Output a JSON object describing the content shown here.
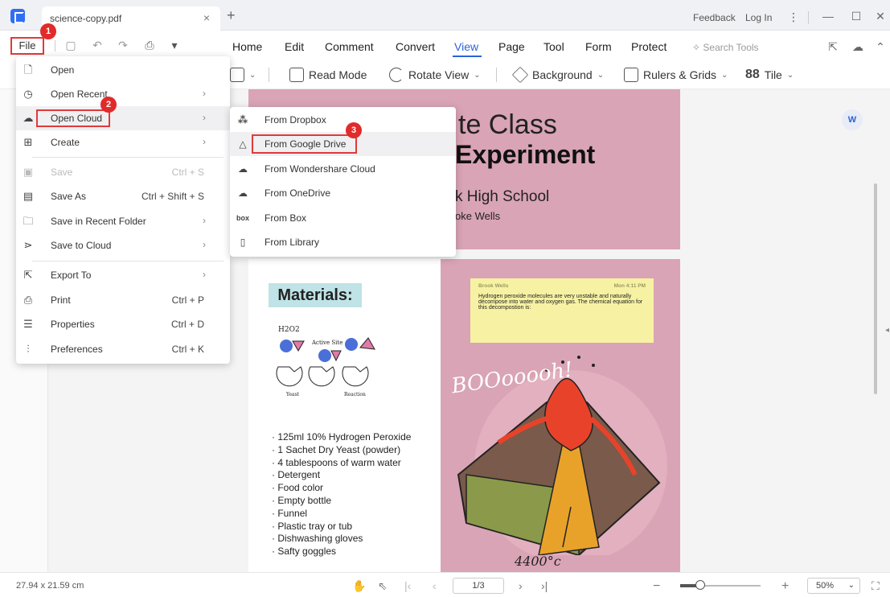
{
  "titlebar": {
    "tab_title": "science-copy.pdf",
    "tab_close": "×",
    "tab_add": "+",
    "feedback": "Feedback",
    "login": "Log In",
    "more": "⋮",
    "minimize": "—",
    "maximize": "☐",
    "close": "✕"
  },
  "ribbon": {
    "file_label": "File",
    "tabs": [
      {
        "label": "Home"
      },
      {
        "label": "Edit"
      },
      {
        "label": "Comment"
      },
      {
        "label": "Convert"
      },
      {
        "label": "View"
      },
      {
        "label": "Page"
      },
      {
        "label": "Tool"
      },
      {
        "label": "Form"
      },
      {
        "label": "Protect"
      }
    ],
    "active_tab": "View",
    "search_tools": "Search Tools",
    "accent_color": "#2b63d9"
  },
  "toolbar": {
    "read_mode": "Read Mode",
    "rotate_view": "Rotate View",
    "background": "Background",
    "rulers_grids": "Rulers & Grids",
    "tile": "Tile"
  },
  "file_menu": {
    "items": [
      {
        "label": "Open",
        "shortcut": "",
        "icon": "open-icon"
      },
      {
        "label": "Open Recent",
        "shortcut": "",
        "icon": "clock-icon",
        "arrow": "›"
      },
      {
        "label": "Open Cloud",
        "shortcut": "",
        "icon": "cloud-icon",
        "arrow": "›"
      },
      {
        "label": "Create",
        "shortcut": "",
        "icon": "plus-icon",
        "arrow": "›"
      },
      {
        "label": "Save",
        "shortcut": "Ctrl + S",
        "icon": "save-icon",
        "disabled": true
      },
      {
        "label": "Save As",
        "shortcut": "Ctrl + Shift + S",
        "icon": "save-as-icon"
      },
      {
        "label": "Save in Recent Folder",
        "shortcut": "",
        "icon": "folder-icon",
        "arrow": "›"
      },
      {
        "label": "Save to Cloud",
        "shortcut": "",
        "icon": "cloud-upload-icon",
        "arrow": "›"
      },
      {
        "label": "Export To",
        "shortcut": "",
        "icon": "export-icon",
        "arrow": "›"
      },
      {
        "label": "Print",
        "shortcut": "Ctrl + P",
        "icon": "print-icon"
      },
      {
        "label": "Properties",
        "shortcut": "Ctrl + D",
        "icon": "list-icon"
      },
      {
        "label": "Preferences",
        "shortcut": "Ctrl + K",
        "icon": "sliders-icon"
      }
    ]
  },
  "cloud_menu": {
    "items": [
      {
        "label": "From Dropbox",
        "icon": "dropbox-icon"
      },
      {
        "label": "From Google Drive",
        "icon": "google-drive-icon"
      },
      {
        "label": "From Wondershare Cloud",
        "icon": "wondershare-cloud-icon"
      },
      {
        "label": "From OneDrive",
        "icon": "onedrive-icon"
      },
      {
        "label": "From Box",
        "icon": "box-icon"
      },
      {
        "label": "From Library",
        "icon": "library-icon"
      }
    ]
  },
  "badges": [
    "1",
    "2",
    "3"
  ],
  "document": {
    "title_line1": "te Class",
    "title_line2": "Experiment",
    "school": "k High School",
    "author": "oke Wells",
    "materials_heading": "Materials:",
    "materials": [
      "125ml 10% Hydrogen Peroxide",
      "1 Sachet Dry Yeast (powder)",
      "4 tablespoons of warm water",
      "Detergent",
      "Food color",
      "Empty bottle",
      "Funnel",
      "Plastic tray or tub",
      "Dishwashing gloves",
      "Safty goggles"
    ],
    "sticky_author": "Brook Wells",
    "sticky_time": "Mon 4:11 PM",
    "sticky_text": "Hydrogen peroxide molecules are very unstable and naturally decompose into water and oxygen gas. The chemical equation for this decompostion is:",
    "diagram_h2o2": "H2O2",
    "diagram_active_site": "Active Site",
    "diagram_yeast": "Yeast",
    "diagram_reaction": "Reaction",
    "boom_text": "BOOooooh!",
    "temperature": "4400°c",
    "page_color": "#d9a4b5"
  },
  "statusbar": {
    "dimensions": "27.94 x 21.59 cm",
    "page": "1/3",
    "zoom": "50%",
    "zoom_fraction": 0.25
  }
}
